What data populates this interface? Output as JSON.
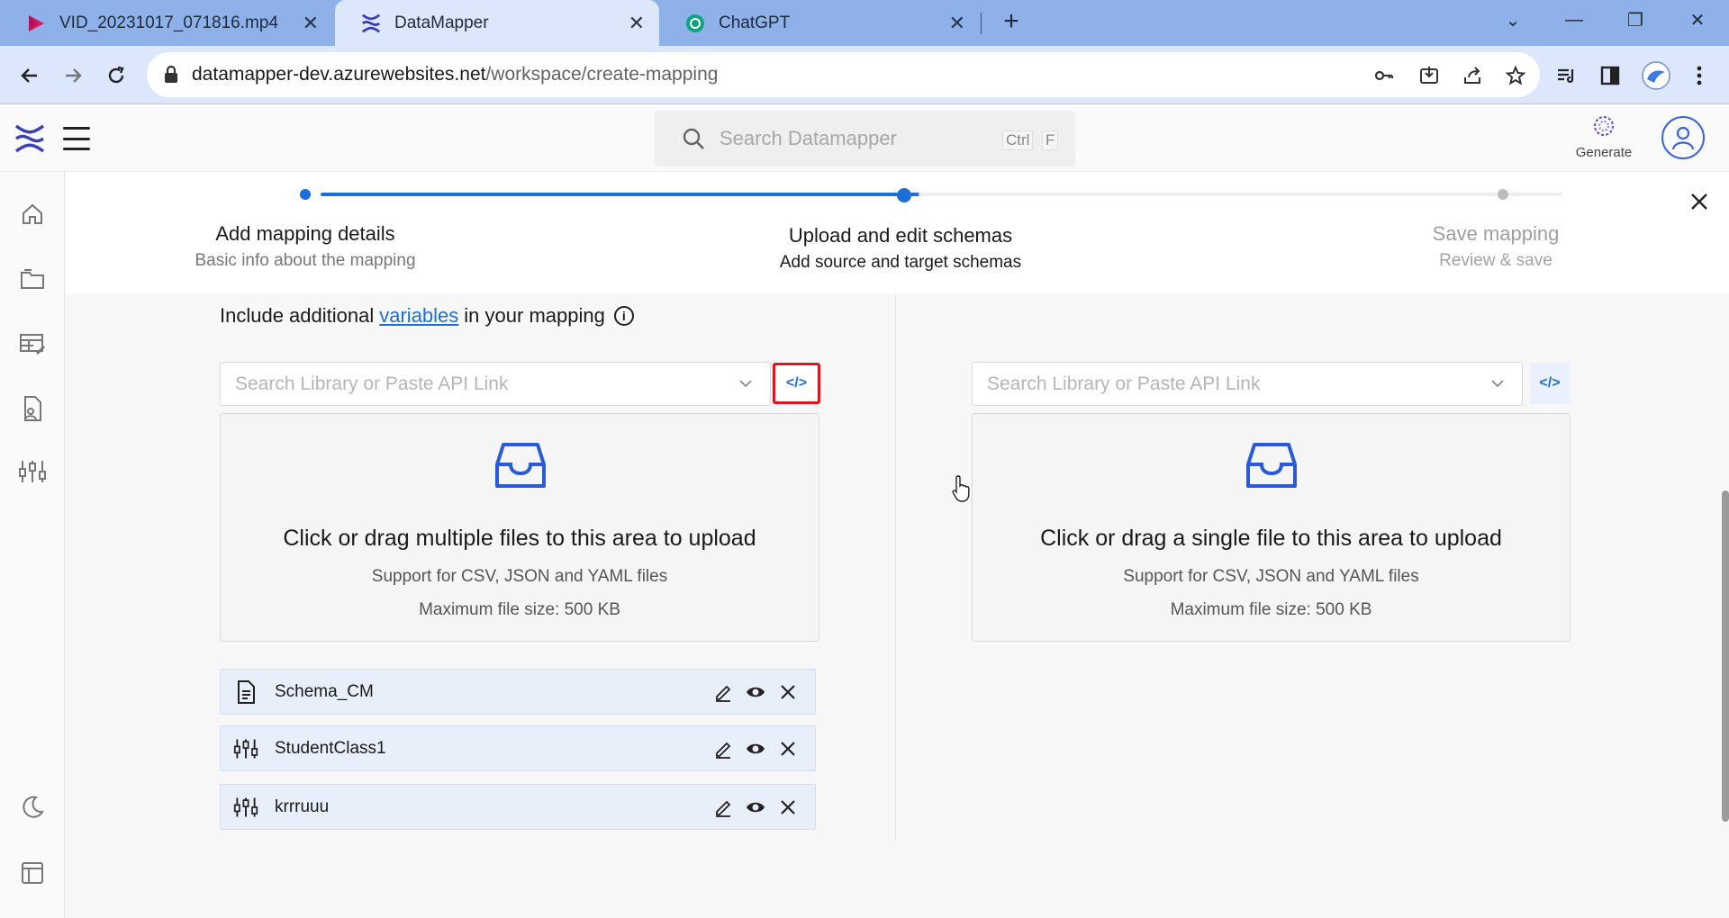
{
  "browser": {
    "tabs": [
      {
        "title": "VID_20231017_071816.mp4",
        "icon": "video-play-icon"
      },
      {
        "title": "DataMapper",
        "icon": "datamapper-logo-icon",
        "active": true
      },
      {
        "title": "ChatGPT",
        "icon": "chatgpt-icon"
      }
    ],
    "url_host": "datamapper-dev.azurewebsites.net",
    "url_path": "/workspace/create-mapping"
  },
  "header": {
    "search_placeholder": "Search Datamapper",
    "shortcut_ctrl": "Ctrl",
    "shortcut_key": "F",
    "generate_label": "Generate"
  },
  "stepper": {
    "steps": [
      {
        "title": "Add mapping details",
        "subtitle": "Basic info about the mapping",
        "state": "done"
      },
      {
        "title": "Upload and edit schemas",
        "subtitle": "Add source and target schemas",
        "state": "current"
      },
      {
        "title": "Save mapping",
        "subtitle": "Review & save",
        "state": "pending"
      }
    ]
  },
  "main": {
    "variables_prefix": "Include additional",
    "variables_link": "variables",
    "variables_suffix": "in your mapping",
    "source": {
      "search_placeholder": "Search Library or Paste API Link",
      "upload_title": "Click or drag multiple files to this area to upload",
      "upload_support": "Support for CSV, JSON and YAML files",
      "upload_maxsize": "Maximum file size: 500 KB",
      "code_button": "</>"
    },
    "target": {
      "search_placeholder": "Search Library or Paste API Link",
      "upload_title": "Click or drag a single file to this area to upload",
      "upload_support": "Support for CSV, JSON and YAML files",
      "upload_maxsize": "Maximum file size: 500 KB",
      "code_button": "</>"
    },
    "files": [
      {
        "name": "Schema_CM",
        "icon": "document-icon"
      },
      {
        "name": "StudentClass1",
        "icon": "sliders-icon"
      },
      {
        "name": "krrruuu",
        "icon": "sliders-icon"
      }
    ]
  },
  "colors": {
    "accent": "#1a6fd8",
    "highlight": "#e0141e",
    "tabstrip": "#8fb1e9",
    "toolbar": "#dce7fb"
  }
}
